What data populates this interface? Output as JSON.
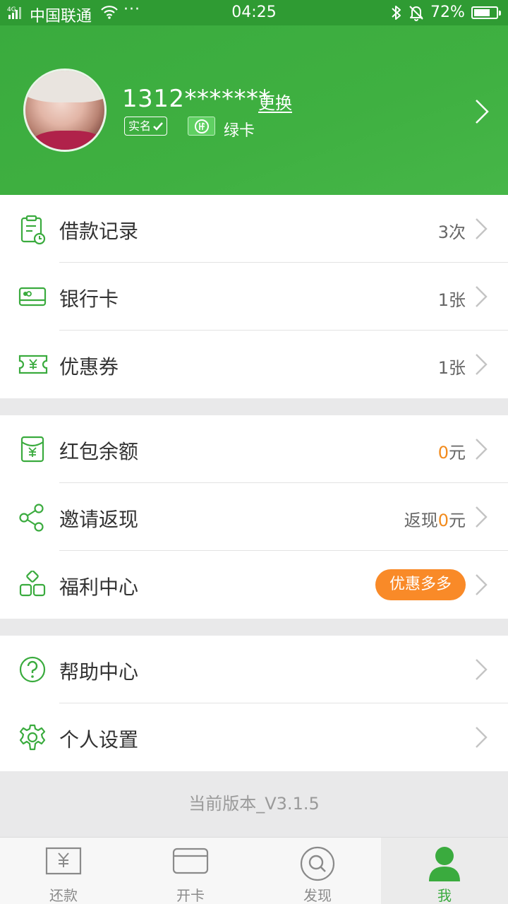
{
  "status_bar": {
    "network": "4G",
    "carrier": "中国联通",
    "dots": "···",
    "time": "04:25",
    "battery_text": "72%",
    "battery_level": 0.72
  },
  "profile": {
    "phone": "1312*******",
    "change_label": "更换",
    "realname_badge": "实名",
    "card_label": "绿卡"
  },
  "groups": [
    {
      "items": [
        {
          "label": "借款记录",
          "value": "3次",
          "icon": "loan-record-icon"
        },
        {
          "label": "银行卡",
          "value": "1张",
          "icon": "bank-card-icon"
        },
        {
          "label": "优惠券",
          "value": "1张",
          "icon": "coupon-icon"
        }
      ]
    },
    {
      "items": [
        {
          "label": "红包余额",
          "value_num": "0",
          "value_unit": "元",
          "icon": "red-packet-icon"
        },
        {
          "label": "邀请返现",
          "value_prefix": "返现",
          "value_num": "0",
          "value_unit": "元",
          "icon": "share-icon"
        },
        {
          "label": "福利中心",
          "badge": "优惠多多",
          "icon": "welfare-icon"
        }
      ]
    },
    {
      "items": [
        {
          "label": "帮助中心",
          "icon": "help-icon"
        },
        {
          "label": "个人设置",
          "icon": "settings-gear-icon"
        }
      ]
    }
  ],
  "version": "当前版本_V3.1.5",
  "tabs": [
    {
      "label": "还款",
      "icon": "repay-icon",
      "active": false
    },
    {
      "label": "开卡",
      "icon": "open-card-icon",
      "active": false
    },
    {
      "label": "发现",
      "icon": "discover-icon",
      "active": false
    },
    {
      "label": "我",
      "icon": "user-icon",
      "active": true
    }
  ],
  "colors": {
    "brand_green": "#3aab3e",
    "accent_orange": "#f28b1d",
    "badge_orange": "#f98a28"
  }
}
